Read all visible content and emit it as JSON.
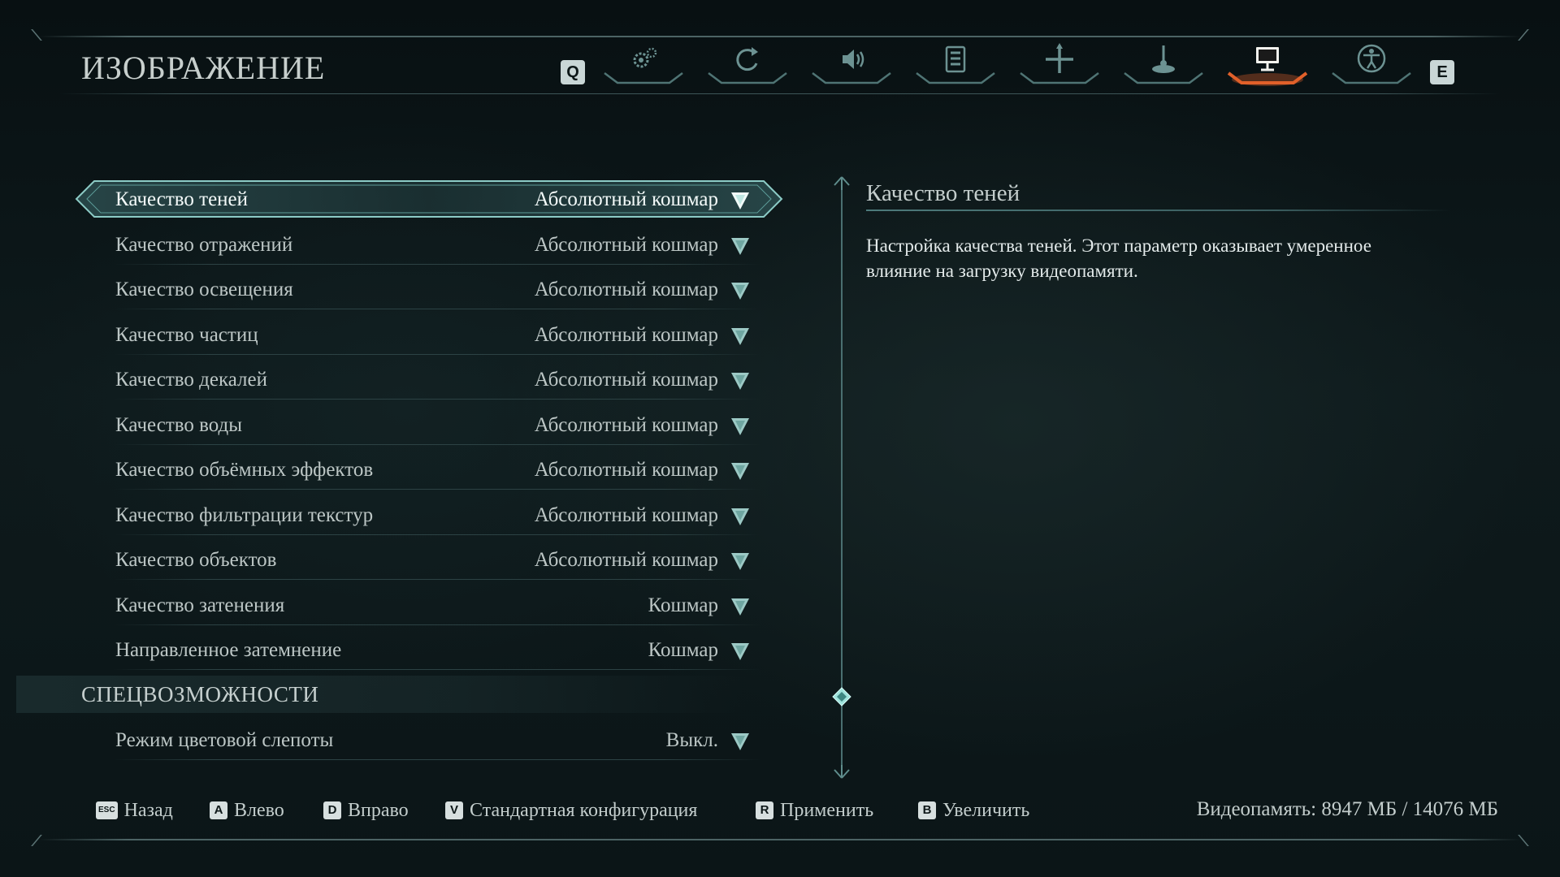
{
  "header": {
    "title": "ИЗОБРАЖЕНИЕ",
    "prev_key": "Q",
    "next_key": "E",
    "tabs": [
      {
        "icon": "gears-icon",
        "active": false
      },
      {
        "icon": "rotate-icon",
        "active": false
      },
      {
        "icon": "speaker-icon",
        "active": false
      },
      {
        "icon": "list-icon",
        "active": false
      },
      {
        "icon": "crosshair-icon",
        "active": false
      },
      {
        "icon": "joystick-icon",
        "active": false
      },
      {
        "icon": "monitor-icon",
        "active": true
      },
      {
        "icon": "accessibility-icon",
        "active": false
      }
    ],
    "active_color": "#e0602a"
  },
  "settings": [
    {
      "label": "Качество теней",
      "value": "Абсолютный кошмар",
      "selected": true
    },
    {
      "label": "Качество отражений",
      "value": "Абсолютный кошмар"
    },
    {
      "label": "Качество освещения",
      "value": "Абсолютный кошмар"
    },
    {
      "label": "Качество частиц",
      "value": "Абсолютный кошмар"
    },
    {
      "label": "Качество декалей",
      "value": "Абсолютный кошмар"
    },
    {
      "label": "Качество воды",
      "value": "Абсолютный кошмар"
    },
    {
      "label": "Качество объёмных эффектов",
      "value": "Абсолютный кошмар"
    },
    {
      "label": "Качество фильтрации текстур",
      "value": "Абсолютный кошмар"
    },
    {
      "label": "Качество объектов",
      "value": "Абсолютный кошмар"
    },
    {
      "label": "Качество затенения",
      "value": "Кошмар"
    },
    {
      "label": "Направленное затемнение",
      "value": "Кошмар"
    }
  ],
  "section": {
    "title": "СПЕЦВОЗМОЖНОСТИ",
    "settings": [
      {
        "label": "Режим цветовой слепоты",
        "value": "Выкл."
      }
    ]
  },
  "detail": {
    "title": "Качество теней",
    "description": "Настройка качества теней. Этот параметр оказывает умеренное влияние на загрузку видеопамяти."
  },
  "footer": {
    "actions": [
      {
        "key": "ESC",
        "label": "Назад"
      },
      {
        "key": "A",
        "label": "Влево"
      },
      {
        "key": "D",
        "label": "Вправо"
      },
      {
        "key": "V",
        "label": "Стандартная конфигурация"
      },
      {
        "key": "R",
        "label": "Применить"
      },
      {
        "key": "B",
        "label": "Увеличить"
      }
    ],
    "vram": "Видеопамять: 8947 МБ / 14076 МБ"
  },
  "accent_color": "#8fd0cc"
}
